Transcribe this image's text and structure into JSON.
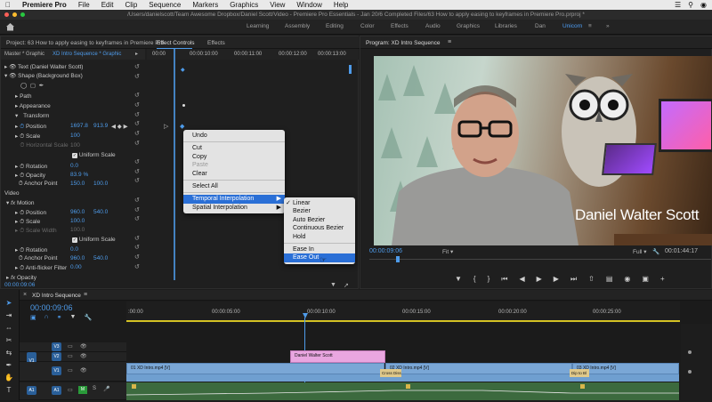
{
  "macbar": {
    "app": "Premiere Pro",
    "menus": [
      "File",
      "Edit",
      "Clip",
      "Sequence",
      "Markers",
      "Graphics",
      "View",
      "Window",
      "Help"
    ]
  },
  "titlebar": {
    "path": "/Users/danielscott/Team Awesome Dropbox/Daniel Scott/Video - Premiere Pro Essentials - Jan 20/6 Completed Files/63 How to apply easing to keyframes in Premiere Pro.prproj *"
  },
  "workspaces": [
    "Learning",
    "Assembly",
    "Editing",
    "Color",
    "Effects",
    "Audio",
    "Graphics",
    "Libraries",
    "Dan",
    "Unicorn"
  ],
  "active_workspace": "Unicorn",
  "project_tab": "Project: 63 How to apply easing to keyframes in Premiere Pro",
  "effect_controls": {
    "tab": "Effect Controls",
    "tab2": "Effects",
    "master": "Master * Graphic",
    "sequence": "XD Intro Sequence * Graphic",
    "ruler": [
      "00:00",
      "00:00:10:00",
      "00:00:11:00",
      "00:00:12:00",
      "00:00:13:00"
    ],
    "text_layer": "Text (Daniel Walter Scott)",
    "shape_layer": "Shape (Background Box)",
    "path": "Path",
    "appearance": "Appearance",
    "transform": "Transform",
    "position_label": "Position",
    "position_x": "1697.8",
    "position_y": "913.9",
    "scale_label": "Scale",
    "scale_value": "100",
    "hscale_label": "Horizontal Scale",
    "hscale_value": "100",
    "uniform_scale": "Uniform Scale",
    "rotation_label": "Rotation",
    "rotation_value": "0.0",
    "opacity_label": "Opacity",
    "opacity_value": "83.9 %",
    "anchor_label": "Anchor Point",
    "anchor_x": "150.0",
    "anchor_y": "100.0",
    "video_section": "Video",
    "motion": "Motion",
    "m_position_label": "Position",
    "m_position_x": "960.0",
    "m_position_y": "540.0",
    "m_scale_label": "Scale",
    "m_scale_value": "100.0",
    "m_scalewidth_label": "Scale Width",
    "m_scalewidth_value": "100.0",
    "m_uniform": "Uniform Scale",
    "m_rotation_label": "Rotation",
    "m_rotation_value": "0.0",
    "m_anchor_label": "Anchor Point",
    "m_anchor_x": "960.0",
    "m_anchor_y": "540.0",
    "antiflicker_label": "Anti-flicker Filter",
    "antiflicker_value": "0.00",
    "opacity2": "Opacity",
    "timecode": "00:00:09:06"
  },
  "context_menu": {
    "items": [
      "Undo",
      "Cut",
      "Copy",
      "Paste",
      "Clear",
      "Select All",
      "Temporal Interpolation",
      "Spatial Interpolation"
    ]
  },
  "submenu": {
    "items": [
      "Linear",
      "Bezier",
      "Auto Bezier",
      "Continuous Bezier",
      "Hold",
      "Ease In",
      "Ease Out"
    ]
  },
  "program": {
    "tab": "Program: XD Intro Sequence",
    "lower_third": "Daniel Walter Scott",
    "timecode": "00:00:09:06",
    "fit": "Fit",
    "quality": "Full",
    "duration": "00:01:44:17"
  },
  "timeline": {
    "tab": "XD Intro Sequence",
    "timecode": "00:00:09:06",
    "ruler": [
      ":00:00",
      "00:00:05:00",
      "00:00:10:00",
      "00:00:15:00",
      "00:00:20:00",
      "00:00:25:00"
    ],
    "track_v3": "V3",
    "track_v2": "V2",
    "track_v1": "V1",
    "track_a1": "A1",
    "v1_src": "V1",
    "a1_src": "A1",
    "graphic_clip": "Daniel Walter Scott",
    "clip1": "01 XD Intro.mp4 [V]",
    "clip2": "02 XD Intro.mp4 [V]",
    "clip3": "03 XD Intro.mp4 [V]",
    "cross_dissolve": "Cross Diss",
    "dip": "Dip to Bl"
  }
}
